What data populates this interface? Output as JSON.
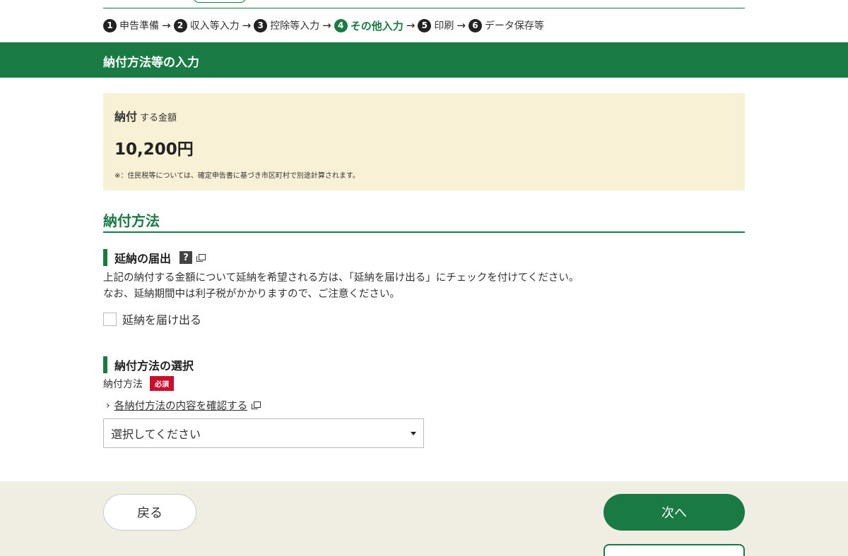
{
  "steps": [
    {
      "num": "1",
      "label": "申告準備"
    },
    {
      "num": "2",
      "label": "収入等入力"
    },
    {
      "num": "3",
      "label": "控除等入力"
    },
    {
      "num": "4",
      "label": "その他入力"
    },
    {
      "num": "5",
      "label": "印刷"
    },
    {
      "num": "6",
      "label": "データ保存等"
    }
  ],
  "page_title": "納付方法等の入力",
  "amount_box": {
    "label_strong": "納付",
    "label_rest": "する金額",
    "value": "10,200円",
    "note": "※：住民税等については、確定申告書に基づき市区町村で別途計算されます。"
  },
  "section_title": "納付方法",
  "extension": {
    "heading": "延納の届出",
    "help_icon": "?",
    "desc_line1": "上記の納付する金額について延納を希望される方は、「延納を届け出る」にチェックを付けてください。",
    "desc_line2": "なお、延納期間中は利子税がかかりますので、ご注意ください。",
    "checkbox_label": "延納を届け出る"
  },
  "payment_method": {
    "heading": "納付方法の選択",
    "field_label": "納付方法",
    "required_label": "必須",
    "chevron": "›",
    "detail_link": "各納付方法の内容を確認する",
    "select_value": "選択してください"
  },
  "footer": {
    "back_label": "戻る",
    "next_label": "次へ"
  },
  "colors": {
    "primary_green": "#1a7a44",
    "required_red": "#c8102e",
    "amount_bg": "#f8f1d6",
    "footer_bg": "#f0ede2"
  }
}
